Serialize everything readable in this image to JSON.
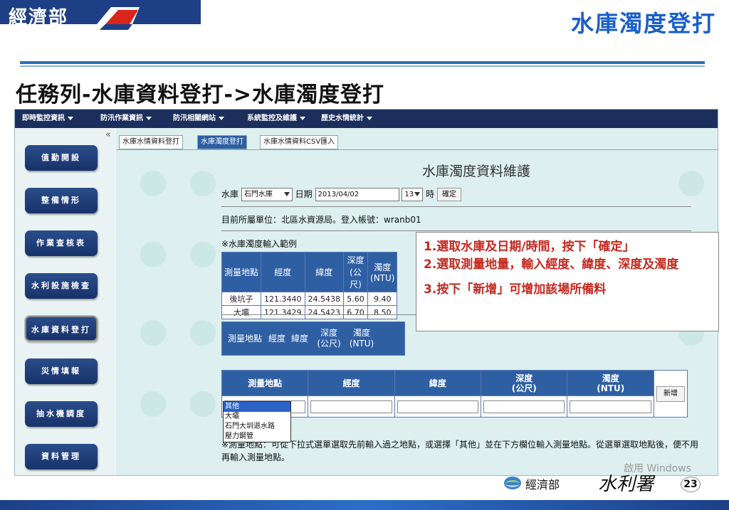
{
  "header": {
    "logo_text": "經濟部",
    "slide_title": "水庫濁度登打"
  },
  "task_heading": "任務列-水庫資料登打->水庫濁度登打",
  "menubar": {
    "items": [
      "即時監控資訊",
      "防汛作業資訊",
      "防汛相關網站",
      "系統監控及維護",
      "歷史水情統計"
    ]
  },
  "sidebar": {
    "collapse_label": "«",
    "items": [
      "值勤開設",
      "整備情形",
      "作業查核表",
      "水利設施檢查",
      "水庫資料登打",
      "災情填報",
      "抽水機調度",
      "資料管理"
    ],
    "active_index": 4
  },
  "tabs": [
    "水庫水情資料登打",
    "水庫濁度登打",
    "水庫水情資料CSV匯入"
  ],
  "active_tab": 1,
  "page_title": "水庫濁度資料維護",
  "filter": {
    "reservoir_label": "水庫",
    "reservoir_value": "石門水庫",
    "date_label": "日期",
    "date_value": "2013/04/02",
    "hour_value": "13",
    "hour_label": "時",
    "confirm_label": "確定"
  },
  "unit_line": "目前所屬單位：北區水資源局。登入帳號：wranb01",
  "example": {
    "title": "※水庫濁度輸入範例",
    "headers": [
      "測量地點",
      "經度",
      "緯度",
      "深度(公尺)",
      "濁度(NTU)"
    ],
    "rows": [
      [
        "後坑子",
        "121.3440",
        "24.5438",
        "5.60",
        "9.40"
      ],
      [
        "大壩",
        "121.3429",
        "24.5423",
        "6.70",
        "8.50"
      ]
    ]
  },
  "empty_table_headers": [
    "測量地點",
    "經度",
    "緯度",
    "深度(公尺)",
    "濁度(NTU)"
  ],
  "entry": {
    "headers": [
      "測量地點",
      "經度",
      "緯度",
      "深度\n(公尺)",
      "濁度\n(NTU)"
    ],
    "add_label": "新增",
    "dropdown_options": [
      "其他",
      "大壩",
      "石門大圳退水路",
      "壓力鋼管"
    ],
    "dropdown_selected": 0
  },
  "note": "※測量地點：可從下拉式選單選取先前輸入過之地點，或選擇「其他」並在下方欄位輸入測量地點。從選單選取地點後，便不用再輸入測量地點。",
  "callout": {
    "line1": "1.選取水庫及日期/時間，按下「確定」",
    "line2": "2.選取測量地量，輸入經度、緯度、深度及濁度",
    "line3": "3.按下「新增」可增加該場所備料"
  },
  "footer": {
    "org_text": "經濟部",
    "org_script": "水利署",
    "activate_text": "啟用 Windows",
    "page_number": "23"
  },
  "colors": {
    "title_blue": "#1a5fc8",
    "nav_dark": "#1c2f5c",
    "header_blue": "#2f5fa3",
    "callout_red": "#c6281f"
  }
}
